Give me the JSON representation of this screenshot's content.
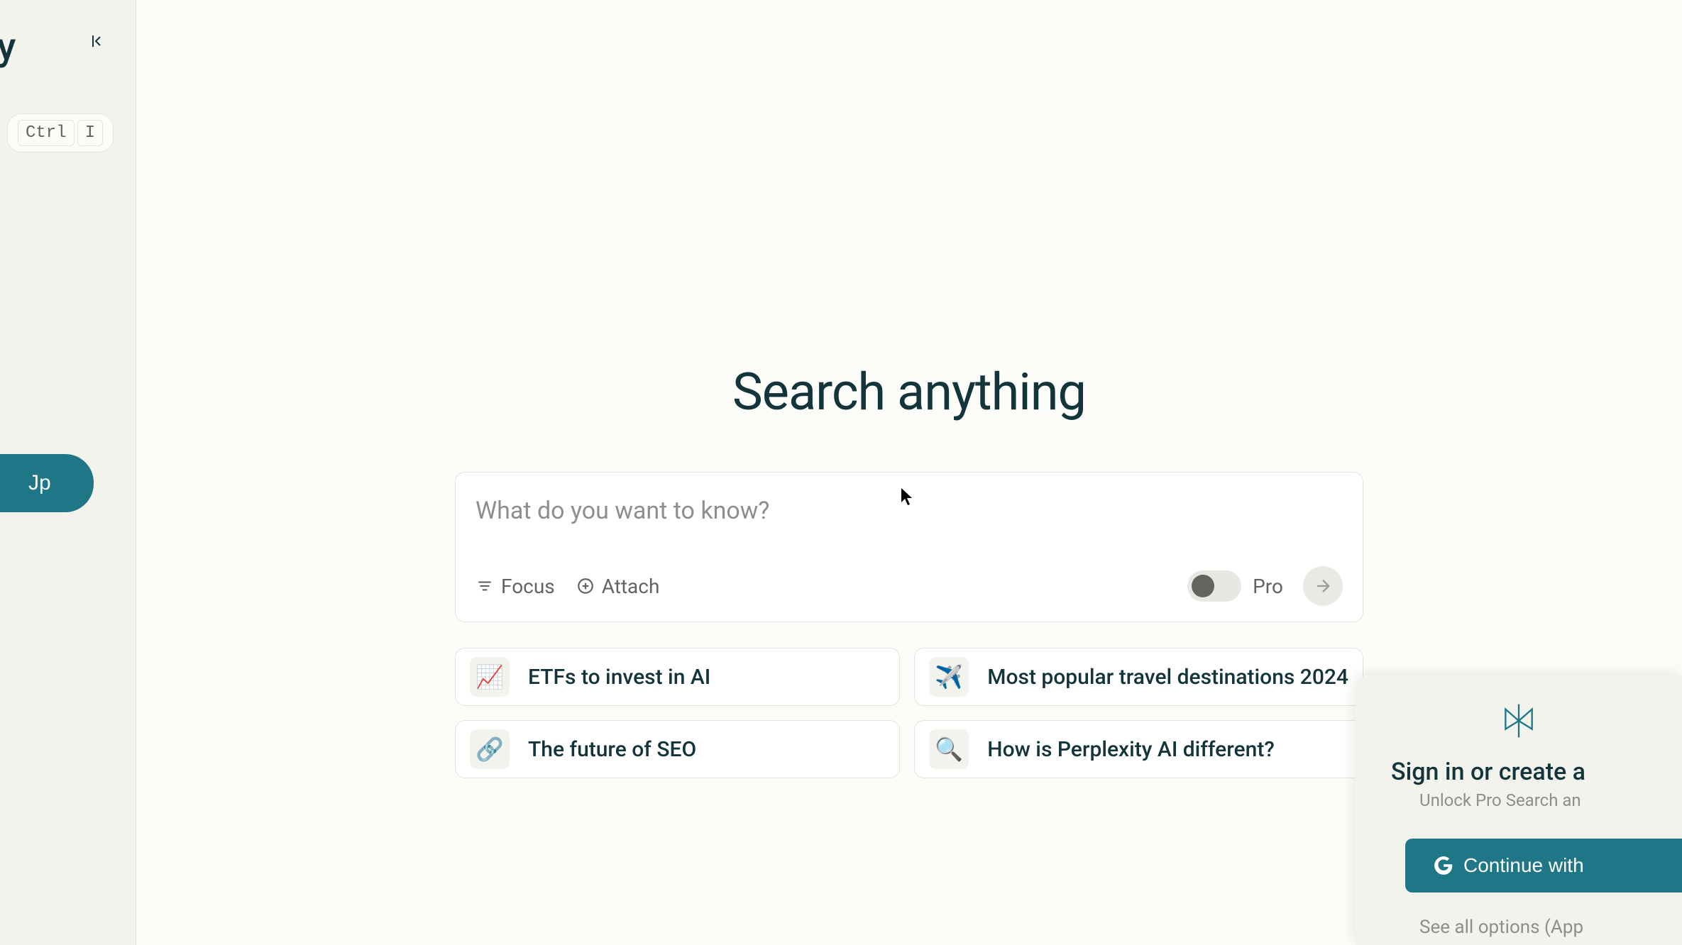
{
  "sidebar": {
    "logo_fragment": "xity",
    "shortcut_key1": "Ctrl",
    "shortcut_key2": "I",
    "signup_label": "Jp"
  },
  "main": {
    "heading": "Search anything",
    "search_placeholder": "What do you want to know?",
    "focus_label": "Focus",
    "attach_label": "Attach",
    "pro_label": "Pro"
  },
  "suggestions": [
    {
      "icon": "📈",
      "text": "ETFs to invest in AI"
    },
    {
      "icon": "✈️",
      "text": "Most popular travel destinations 2024"
    },
    {
      "icon": "🔗",
      "text": "The future of SEO"
    },
    {
      "icon": "🔍",
      "text": "How is Perplexity AI different?"
    }
  ],
  "signin": {
    "title": "Sign in or create a",
    "subtitle": "Unlock Pro Search an",
    "google_label": "Continue with",
    "see_all": "See all options (App"
  }
}
